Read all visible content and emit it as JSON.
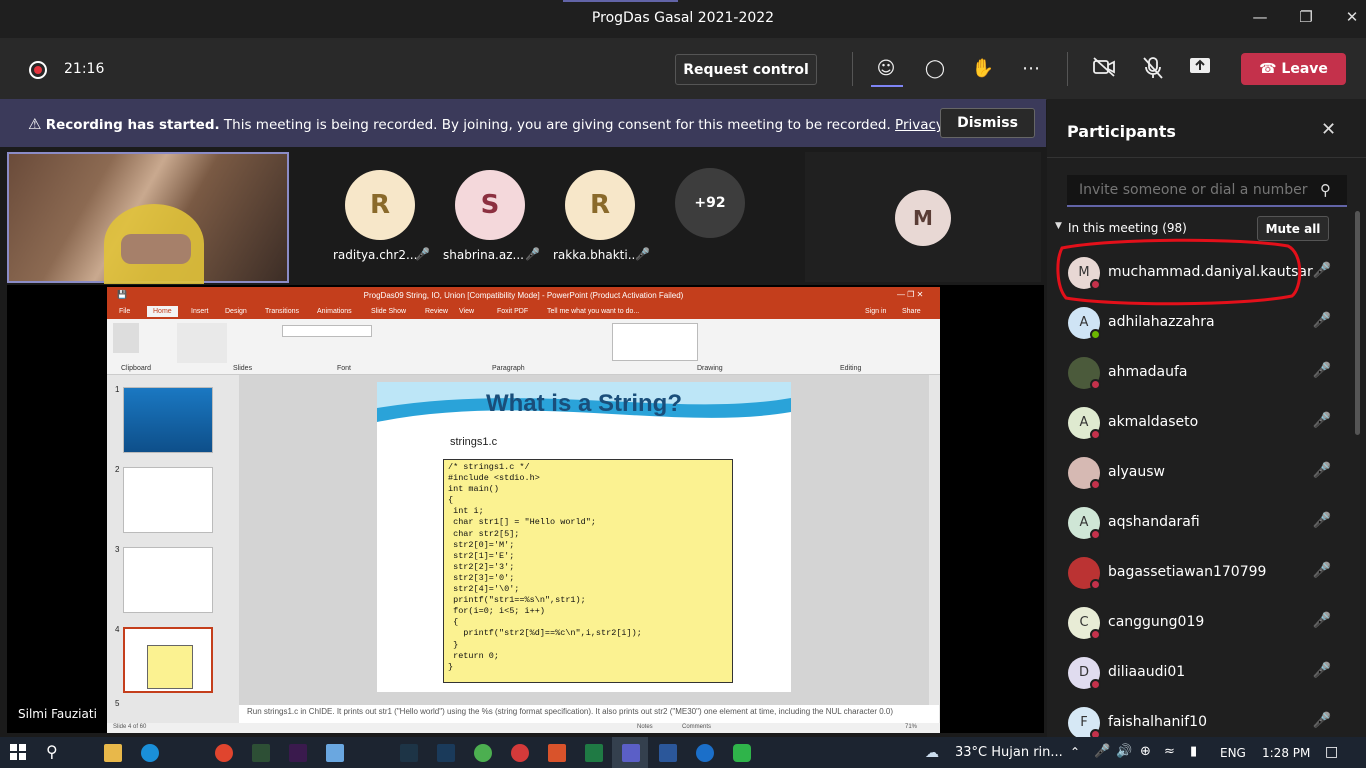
{
  "window": {
    "title": "ProgDas Gasal 2021-2022"
  },
  "toolbar": {
    "timer": "21:16",
    "request_control": "Request control",
    "leave": "Leave"
  },
  "banner": {
    "bold": "Recording has started.",
    "text": " This meeting is being recorded. By joining, you are giving consent for this meeting to be recorded. ",
    "link": "Privacy policy",
    "dismiss": "Dismiss"
  },
  "gallery": {
    "tiles": [
      {
        "initial": "R",
        "name": "raditya.chr2...",
        "bg": "#f7e7c9",
        "fg": "#8a6a2b"
      },
      {
        "initial": "S",
        "name": "shabrina.az...",
        "bg": "#f4d8db",
        "fg": "#8c3040"
      },
      {
        "initial": "R",
        "name": "rakka.bhakti...",
        "bg": "#f7e7c9",
        "fg": "#8a6a2b"
      }
    ],
    "overflow": "+92",
    "m_initial": "M",
    "presenter": "Silmi Fauziati"
  },
  "ppt": {
    "title": "ProgDas09 String, IO, Union [Compatibility Mode] - PowerPoint (Product Activation Failed)",
    "tabs": [
      "File",
      "Home",
      "Insert",
      "Design",
      "Transitions",
      "Animations",
      "Slide Show",
      "Review",
      "View",
      "Foxit PDF",
      "Tell me what you want to do..."
    ],
    "signin": "Sign in",
    "share": "Share",
    "groups": [
      "Clipboard",
      "Slides",
      "Font",
      "Paragraph",
      "Drawing",
      "Editing"
    ],
    "slide_title": "What is a String?",
    "slide_label": "strings1.c",
    "code": "/* strings1.c */\n#include <stdio.h>\nint main()\n{\n int i;\n char str1[] = \"Hello world\";\n char str2[5];\n str2[0]='M';\n str2[1]='E';\n str2[2]='3';\n str2[3]='0';\n str2[4]='\\0';\n printf(\"str1==%s\\n\",str1);\n for(i=0; i<5; i++)\n {\n   printf(\"str2[%d]==%c\\n\",i,str2[i]);\n }\n return 0;\n}",
    "notes": "Run strings1.c in ChIDE. It prints out str1 (\"Hello world\") using the %s (string format specification). It also prints out str2 (\"ME30\") one element at time, including the NUL character 0.0)",
    "status": "Slide 4 of 60",
    "notes_btn": "Notes",
    "comments_btn": "Comments",
    "zoom": "71%",
    "thumbs": [
      "1",
      "2",
      "3",
      "4",
      "5"
    ]
  },
  "panel": {
    "title": "Participants",
    "invite_placeholder": "Invite someone or dial a number",
    "in_meeting": "In this meeting (98)",
    "mute_all": "Mute all",
    "people": [
      {
        "initial": "M",
        "name": "muchammad.daniyal.kautsar",
        "bg": "#e8d8d4",
        "status": "red"
      },
      {
        "initial": "A",
        "name": "adhilahazzahra",
        "bg": "#cfe4f5",
        "status": "green"
      },
      {
        "initial": "",
        "name": "ahmadaufa",
        "bg": "#4b5a3b",
        "status": "red"
      },
      {
        "initial": "A",
        "name": "akmaldaseto",
        "bg": "#dfead0",
        "status": "red"
      },
      {
        "initial": "",
        "name": "alyausw",
        "bg": "#d6b9b3",
        "status": "red"
      },
      {
        "initial": "A",
        "name": "aqshandarafi",
        "bg": "#cfe6d6",
        "status": "red"
      },
      {
        "initial": "",
        "name": "bagassetiawan170799",
        "bg": "#b33",
        "status": "red"
      },
      {
        "initial": "C",
        "name": "canggung019",
        "bg": "#e8ecd6",
        "status": "red"
      },
      {
        "initial": "D",
        "name": "diliaaudi01",
        "bg": "#e0dcef",
        "status": "red"
      },
      {
        "initial": "F",
        "name": "faishalhanif10",
        "bg": "#d6e8f5",
        "status": "red"
      }
    ]
  },
  "taskbar": {
    "weather": "33°C  Hujan rin...",
    "lang": "ENG",
    "time": "1:28 PM"
  }
}
